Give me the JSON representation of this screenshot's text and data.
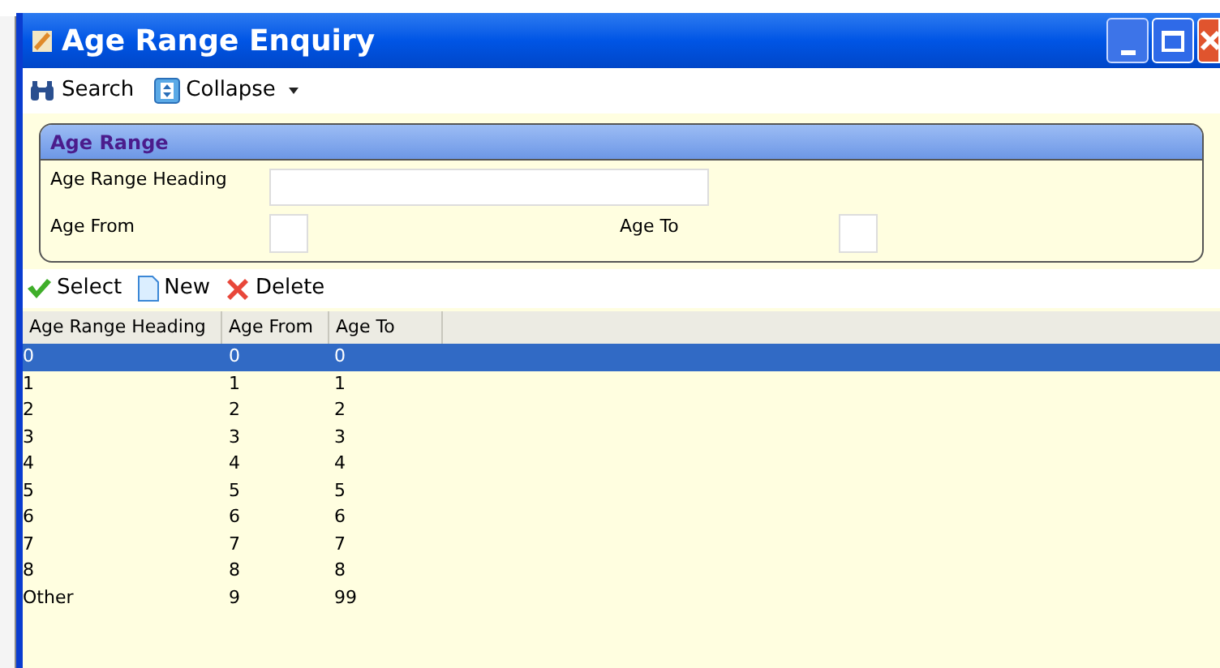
{
  "window": {
    "title": "Age Range Enquiry"
  },
  "toolbar": [
    {
      "kind": "search",
      "label": "Search"
    },
    {
      "kind": "collapse",
      "label": "Collapse"
    }
  ],
  "panel": {
    "title": "Age Range",
    "fields": [
      {
        "label": "Age Range Heading"
      },
      {
        "label": "Age From"
      },
      {
        "label": "Age To"
      }
    ]
  },
  "actions": [
    {
      "kind": "select",
      "label": "Select"
    },
    {
      "kind": "new",
      "label": "New"
    },
    {
      "kind": "delete",
      "label": "Delete"
    }
  ],
  "table": {
    "columns": [
      "Age Range Heading",
      "Age From",
      "Age To"
    ],
    "rows": [
      {
        "cells": [
          "0",
          "0",
          "0"
        ],
        "selected": true
      },
      {
        "cells": [
          "1",
          "1",
          "1"
        ],
        "selected": false
      },
      {
        "cells": [
          "2",
          "2",
          "2"
        ],
        "selected": false
      },
      {
        "cells": [
          "3",
          "3",
          "3"
        ],
        "selected": false
      },
      {
        "cells": [
          "4",
          "4",
          "4"
        ],
        "selected": false
      },
      {
        "cells": [
          "5",
          "5",
          "5"
        ],
        "selected": false
      },
      {
        "cells": [
          "6",
          "6",
          "6"
        ],
        "selected": false
      },
      {
        "cells": [
          "7",
          "7",
          "7"
        ],
        "selected": false
      },
      {
        "cells": [
          "8",
          "8",
          "8"
        ],
        "selected": false
      },
      {
        "cells": [
          "Other",
          "9",
          "99"
        ],
        "selected": false
      }
    ]
  }
}
